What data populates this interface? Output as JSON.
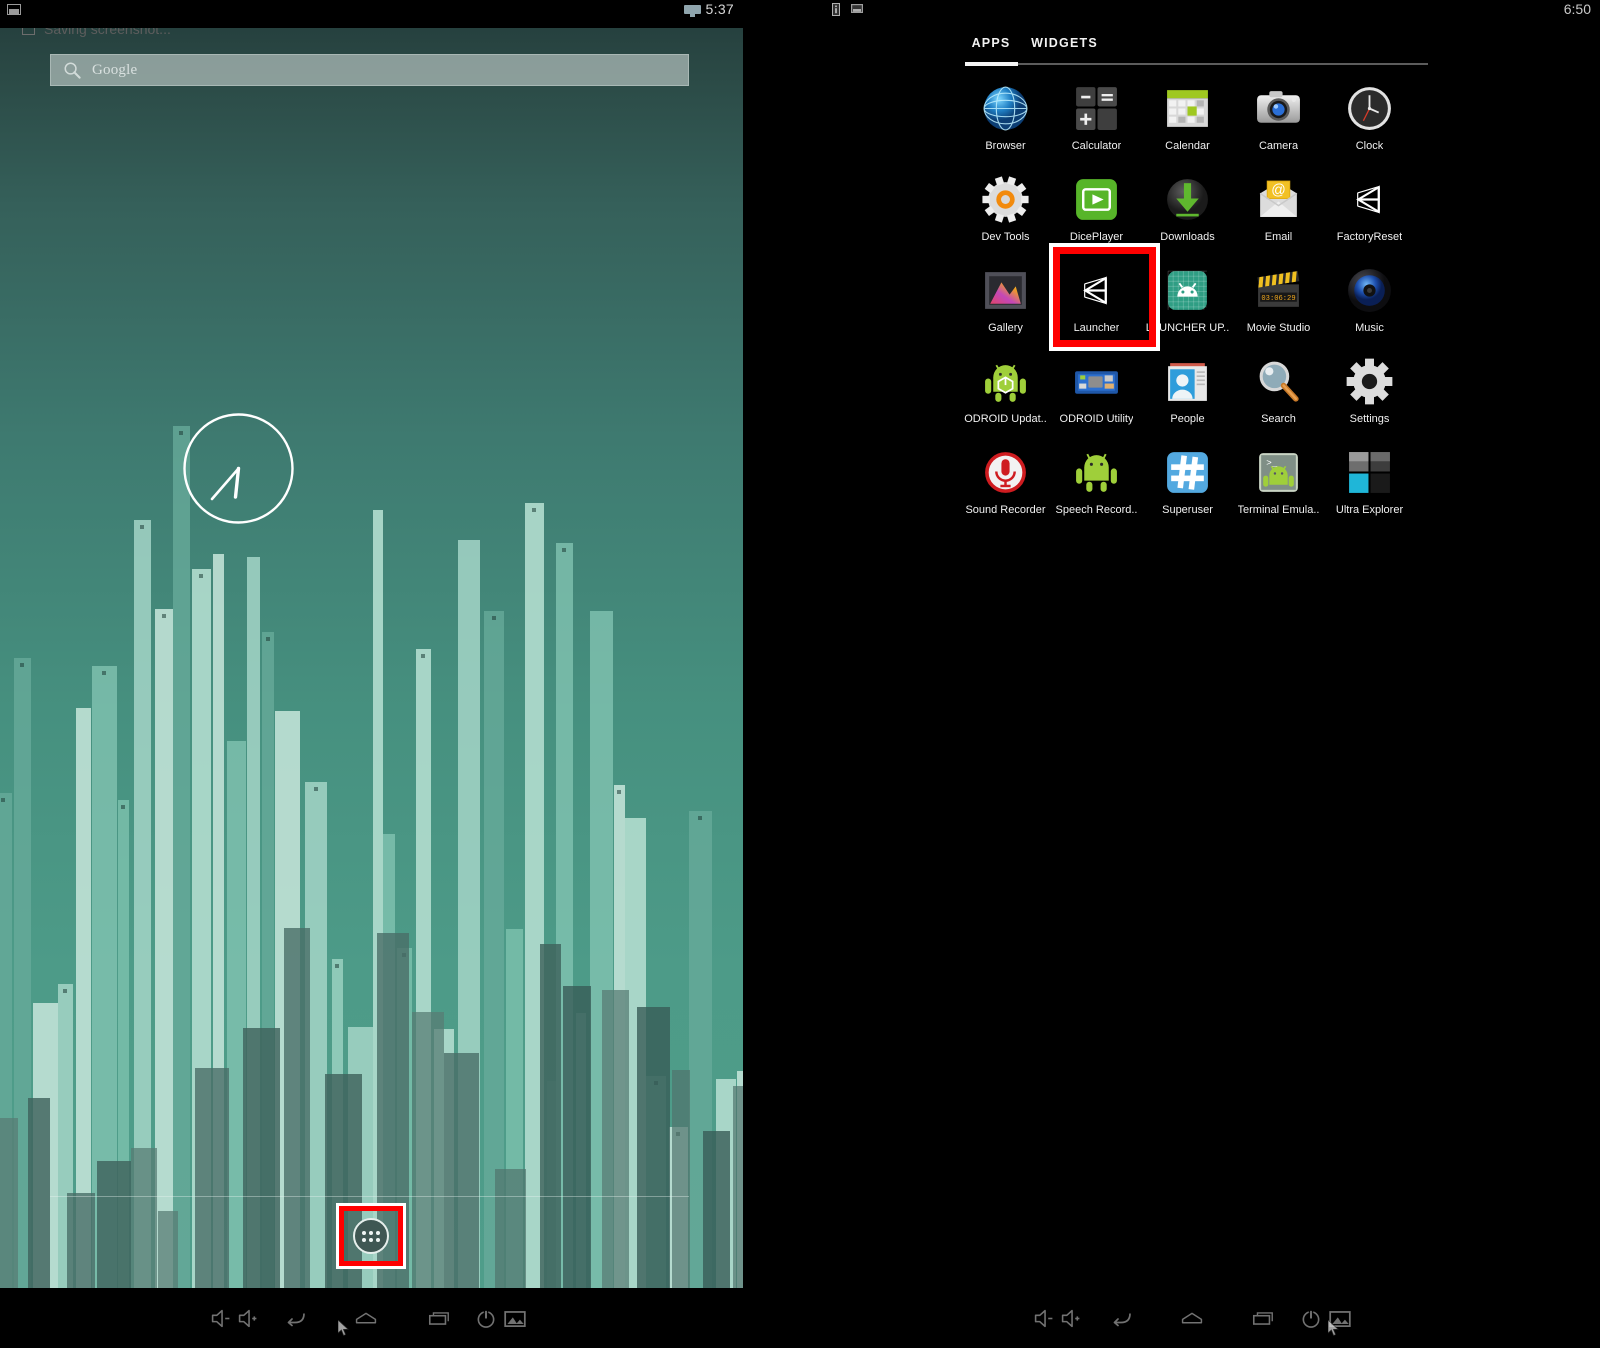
{
  "home": {
    "status": {
      "time": "5:37",
      "notification_icon": "screenshot-icon",
      "ticker_text": "Saving screenshot...",
      "ticker_icon": "image-icon"
    },
    "search": {
      "placeholder": "Google",
      "icon": "search-icon"
    },
    "clock_widget": {
      "name": "analog-clock-widget",
      "hour": 5,
      "minute": 37
    },
    "drawer_button": {
      "label": "",
      "icon": "apps-grid-icon",
      "highlighted": true,
      "highlight_color": "#fe0000"
    },
    "wallpaper_name": "cityscape-teal-wallpaper"
  },
  "drawer": {
    "status": {
      "time": "6:50",
      "icons": [
        "info-icon",
        "screenshot-icon"
      ]
    },
    "tabs": [
      {
        "label": "APPS",
        "selected": true
      },
      {
        "label": "WIDGETS",
        "selected": false
      }
    ],
    "highlight_color": "#fe0000",
    "highlighted_app": "Launcher",
    "apps": [
      {
        "label": "Browser",
        "icon": "browser-globe-icon"
      },
      {
        "label": "Calculator",
        "icon": "calculator-icon"
      },
      {
        "label": "Calendar",
        "icon": "calendar-icon"
      },
      {
        "label": "Camera",
        "icon": "camera-icon"
      },
      {
        "label": "Clock",
        "icon": "clock-icon"
      },
      {
        "label": "Dev Tools",
        "icon": "gear-orange-icon"
      },
      {
        "label": "DicePlayer",
        "icon": "play-green-icon"
      },
      {
        "label": "Downloads",
        "icon": "download-arrow-icon"
      },
      {
        "label": "Email",
        "icon": "envelope-at-icon"
      },
      {
        "label": "FactoryReset",
        "icon": "unity-logo-icon"
      },
      {
        "label": "Gallery",
        "icon": "gallery-photo-icon"
      },
      {
        "label": "Launcher",
        "icon": "unity-logo-icon"
      },
      {
        "label": "LAUNCHER UP..",
        "icon": "android-head-teal-icon"
      },
      {
        "label": "Movie Studio",
        "icon": "clapperboard-icon"
      },
      {
        "label": "Music",
        "icon": "speaker-blue-icon"
      },
      {
        "label": "ODROID Updat..",
        "icon": "android-box-icon"
      },
      {
        "label": "ODROID Utility",
        "icon": "circuit-board-icon"
      },
      {
        "label": "People",
        "icon": "contact-card-icon"
      },
      {
        "label": "Search",
        "icon": "magnifier-icon"
      },
      {
        "label": "Settings",
        "icon": "gear-icon"
      },
      {
        "label": "Sound Recorder",
        "icon": "microphone-red-icon"
      },
      {
        "label": "Speech Record..",
        "icon": "android-green-icon"
      },
      {
        "label": "Superuser",
        "icon": "hash-blue-icon"
      },
      {
        "label": "Terminal Emula..",
        "icon": "terminal-android-icon"
      },
      {
        "label": "Ultra Explorer",
        "icon": "four-pane-icon"
      }
    ]
  },
  "navbar": {
    "buttons": [
      {
        "name": "volume-down-button",
        "icon": "volume-down-icon"
      },
      {
        "name": "volume-up-button",
        "icon": "volume-up-icon"
      },
      {
        "name": "back-button",
        "icon": "back-arrow-icon"
      },
      {
        "name": "home-button",
        "icon": "home-icon"
      },
      {
        "name": "recents-button",
        "icon": "recents-icon"
      },
      {
        "name": "power-button",
        "icon": "power-icon"
      },
      {
        "name": "screenshot-button",
        "icon": "screenshot-icon"
      }
    ]
  }
}
